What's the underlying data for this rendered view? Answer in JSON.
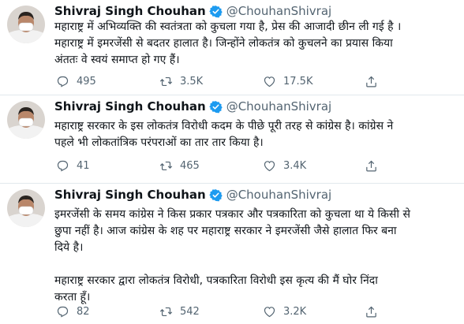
{
  "colors": {
    "verified": "#1d9bf0",
    "secondary_text": "#536471",
    "divider": "#e1e8ed"
  },
  "tweets": [
    {
      "name": "Shivraj Singh Chouhan",
      "handle": "@ChouhanShivraj",
      "text": "महाराष्ट्र में अभिव्यक्ति की स्वतंत्रता को कुचला गया है, प्रेस की आजादी छीन ली गई है ।\nमहाराष्ट्र में इमरजेंसी से बदतर हालात है। जिन्होंने लोकतंत्र को कुचलने का प्रयास किया\nअंततः वे स्वयं समाप्त हो गए हैं।",
      "replies": "495",
      "retweets": "3.5K",
      "likes": "17.5K"
    },
    {
      "name": "Shivraj Singh Chouhan",
      "handle": "@ChouhanShivraj",
      "text": "महाराष्ट्र सरकार के इस लोकतंत्र विरोधी कदम के पीछे पूरी तरह से कांग्रेस है। कांग्रेस ने\nपहले भी लोकतांत्रिक परंपराओं का तार तार किया है।",
      "replies": "41",
      "retweets": "465",
      "likes": "3.4K"
    },
    {
      "name": "Shivraj Singh Chouhan",
      "handle": "@ChouhanShivraj",
      "text": "इमरजेंसी के समय कांग्रेस ने किस प्रकार पत्रकार और पत्रकारिता को कुचला था ये किसी से\nछुपा नहीं है। आज कांग्रेस के शह पर महाराष्ट्र सरकार ने इमरजेंसी जैसे हालात फिर बना\nदिये है।\n\nमहाराष्ट्र सरकार द्वारा लोकतंत्र विरोधी, पत्रकारिता विरोधी इस कृत्य की मैं घोर निंदा\nकरता हूँ।",
      "replies": "82",
      "retweets": "542",
      "likes": "3.2K"
    }
  ]
}
